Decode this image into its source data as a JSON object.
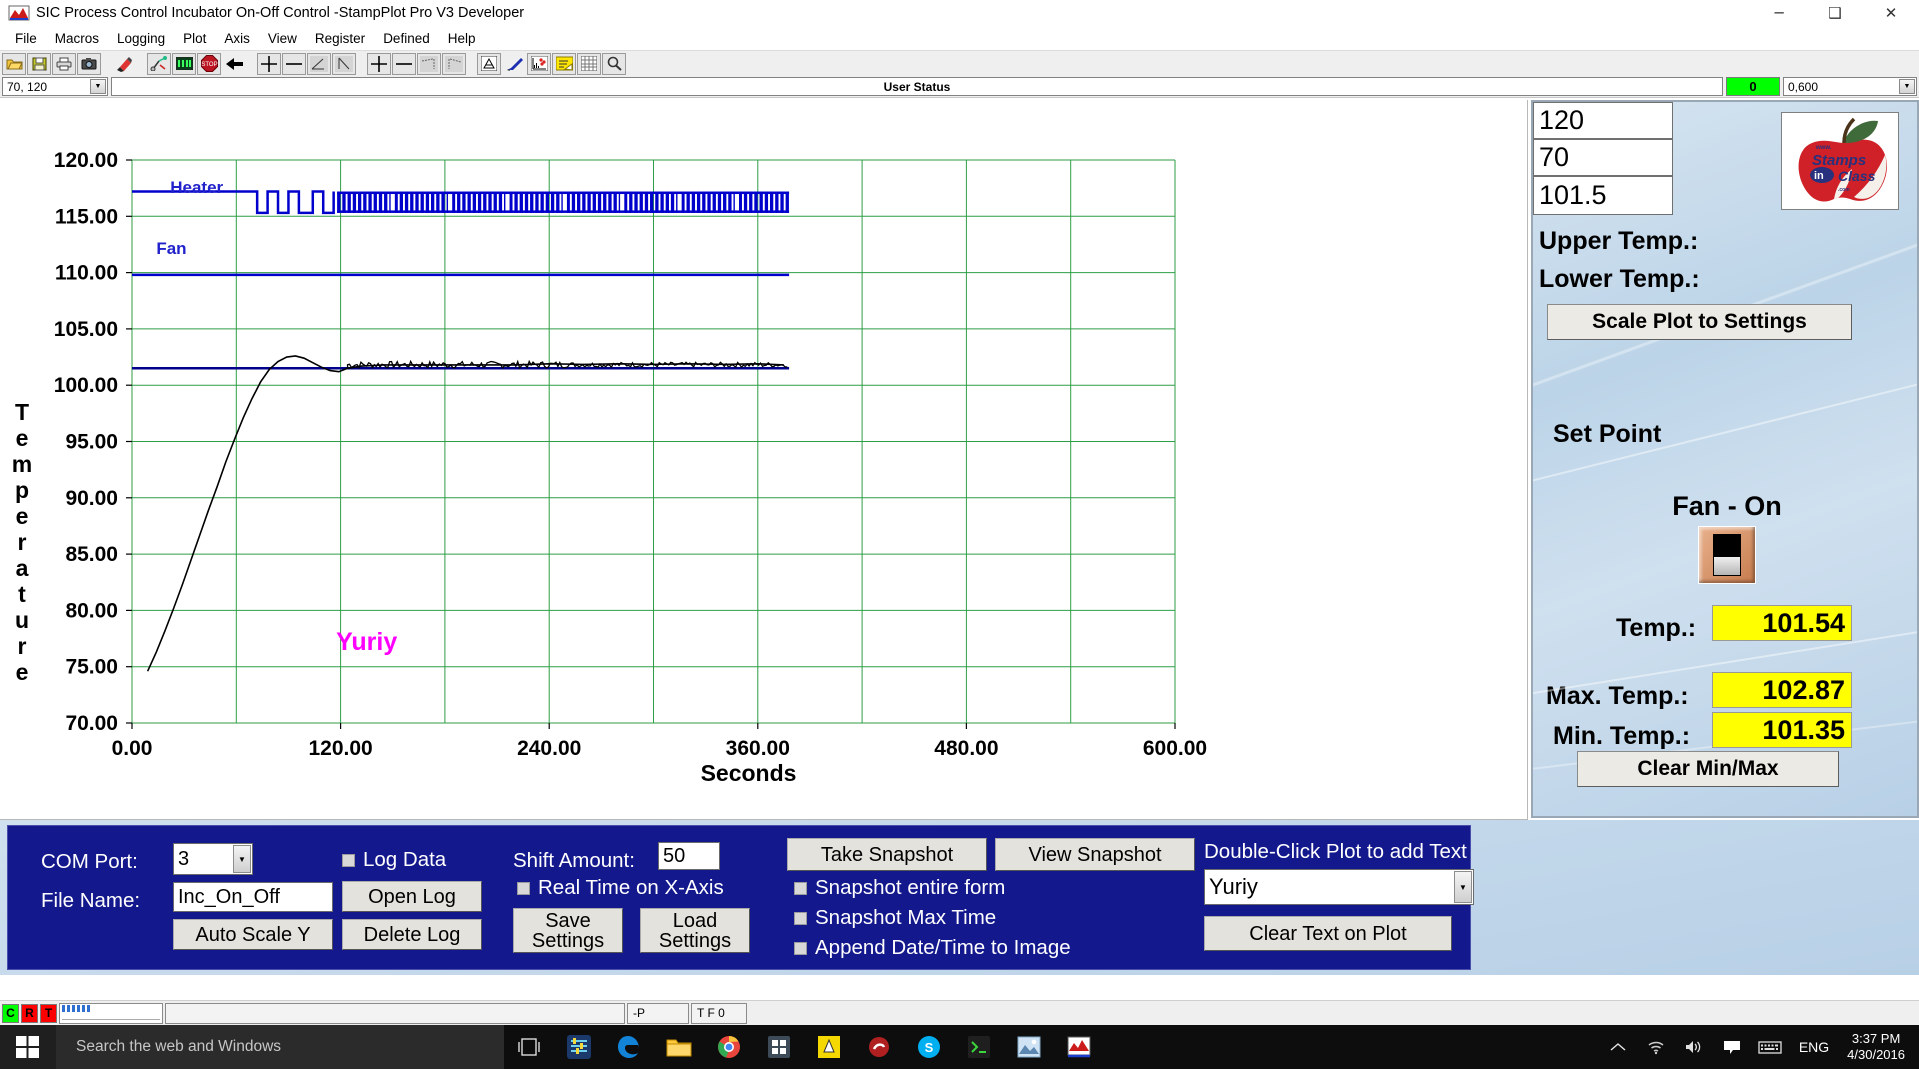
{
  "window": {
    "title": "SIC Process Control Incubator On-Off Control -StampPlot Pro V3 Developer",
    "minimize": "─",
    "maximize": "❑",
    "close": "✕"
  },
  "menu": [
    "File",
    "Macros",
    "Logging",
    "Plot",
    "Axis",
    "View",
    "Register",
    "Defined",
    "Help"
  ],
  "toolbar": {
    "icons": [
      "open-folder-icon",
      "save-disk-icon",
      "print-icon",
      "camera-icon",
      "marker-pen-icon",
      "connect-icon",
      "led-display-icon",
      "stop-icon",
      "back-arrow-icon",
      "plus-icon",
      "minus-icon",
      "scale-up-icon",
      "scale-down-icon",
      "plus-x-icon",
      "minus-x-icon",
      "expand-left-icon",
      "expand-right-icon",
      "pdf-icon",
      "pen-icon",
      "data-points-icon",
      "notes-icon",
      "grid-icon",
      "zoom-icon"
    ]
  },
  "statusrow": {
    "range_value": "70, 120",
    "user_status": "User Status",
    "counter": "0",
    "time_range": "0,600"
  },
  "chart_data": {
    "type": "line",
    "title": "",
    "xlabel": "Seconds",
    "ylabel": "Temperature",
    "xlim": [
      0,
      600
    ],
    "ylim": [
      70,
      120
    ],
    "xticks": [
      "0.00",
      "120.00",
      "240.00",
      "360.00",
      "480.00",
      "600.00"
    ],
    "xtick_values": [
      0,
      120,
      240,
      360,
      480,
      600
    ],
    "yticks": [
      "120.00",
      "115.00",
      "110.00",
      "105.00",
      "100.00",
      "95.00",
      "90.00",
      "85.00",
      "80.00",
      "75.00",
      "70.00"
    ],
    "ytick_values": [
      120,
      115,
      110,
      105,
      100,
      95,
      90,
      85,
      80,
      75,
      70
    ],
    "grid": true,
    "grid_color": "#2e9e45",
    "minor_x_step": 60,
    "annotation": {
      "text": "Yuriy",
      "color": "#ff00ff",
      "x": 135,
      "y": 76.5
    },
    "series": [
      {
        "name": "Heater",
        "label_x": 22,
        "label_y": 117.6,
        "color": "#0000cc",
        "type": "digital",
        "baseline": 117.2,
        "high": 117.2,
        "low": 115.3,
        "comment": "digital heater on/off trace plotted near top of plot"
      },
      {
        "name": "Fan",
        "label_x": 14,
        "label_y": 112.2,
        "color": "#0000cc",
        "type": "digital",
        "baseline": 109.8,
        "comment": "fan state line held constant at 109.8 across run"
      },
      {
        "name": "Set Point",
        "color": "#00008b",
        "type": "reference",
        "value": 101.5
      },
      {
        "name": "Temperature",
        "color": "#000000",
        "type": "line",
        "points": [
          [
            9,
            74.6
          ],
          [
            14,
            76.3
          ],
          [
            19,
            78.2
          ],
          [
            24,
            80.2
          ],
          [
            29,
            82.3
          ],
          [
            34,
            84.5
          ],
          [
            39,
            86.7
          ],
          [
            44,
            88.9
          ],
          [
            49,
            91.0
          ],
          [
            54,
            93.2
          ],
          [
            59,
            95.2
          ],
          [
            64,
            97.1
          ],
          [
            69,
            98.8
          ],
          [
            74,
            100.3
          ],
          [
            79,
            101.4
          ],
          [
            84,
            102.1
          ],
          [
            89,
            102.5
          ],
          [
            94,
            102.6
          ],
          [
            99,
            102.4
          ],
          [
            104,
            102.0
          ],
          [
            109,
            101.6
          ],
          [
            114,
            101.3
          ],
          [
            119,
            101.2
          ],
          [
            124,
            101.5
          ],
          [
            132,
            101.7
          ],
          [
            145,
            101.8
          ],
          [
            160,
            101.8
          ],
          [
            180,
            101.8
          ],
          [
            200,
            101.8
          ],
          [
            220,
            101.8
          ],
          [
            240,
            101.9
          ],
          [
            260,
            101.85
          ],
          [
            280,
            101.9
          ],
          [
            300,
            101.85
          ],
          [
            320,
            101.9
          ],
          [
            340,
            101.85
          ],
          [
            360,
            101.9
          ],
          [
            375,
            101.8
          ]
        ]
      }
    ]
  },
  "settings": {
    "upper_temp_label": "Upper Temp.:",
    "upper_temp_value": "120",
    "lower_temp_label": "Lower Temp.:",
    "lower_temp_value": "70",
    "scale_button": "Scale Plot to Settings",
    "set_point_label": "Set Point",
    "set_point_value": "101.5",
    "fan_status": "Fan - On",
    "fan_switch_icon": "toggle-switch-icon",
    "temp_label": "Temp.:",
    "temp_value": "101.54",
    "max_temp_label": "Max. Temp.:",
    "max_temp_value": "102.87",
    "min_temp_label": "Min. Temp.:",
    "min_temp_value": "101.35",
    "clear_button": "Clear Min/Max",
    "logo_alt": "Stamps in Class"
  },
  "controls": {
    "com_port_label": "COM Port:",
    "com_port_value": "3",
    "file_name_label": "File Name:",
    "file_name_value": "Inc_On_Off",
    "auto_scale_button": "Auto Scale Y",
    "log_data_label": "Log Data",
    "open_log_button": "Open Log",
    "delete_log_button": "Delete Log",
    "shift_amount_label": "Shift Amount:",
    "shift_amount_value": "50",
    "real_time_label": "Real Time on X-Axis",
    "save_settings_button": "Save\nSettings",
    "save_settings_line1": "Save",
    "save_settings_line2": "Settings",
    "load_settings_line1": "Load",
    "load_settings_line2": "Settings",
    "take_snapshot_button": "Take Snapshot",
    "view_snapshot_button": "View Snapshot",
    "snapshot_form_label": "Snapshot entire form",
    "snapshot_max_label": "Snapshot Max Time",
    "append_date_label": "Append Date/Time to Image",
    "double_click_label": "Double-Click Plot to add Text",
    "text_value": "Yuriy",
    "clear_text_button": "Clear Text on Plot"
  },
  "appstatus": {
    "ind_c": "C",
    "ind_r": "R",
    "ind_t": "T",
    "field_p": "-P",
    "field_tf0": "T F 0"
  },
  "taskbar": {
    "search_placeholder": "Search the web and Windows",
    "icons": [
      "task-view-icon",
      "mixer-icon",
      "edge-icon",
      "file-explorer-icon",
      "chrome-icon",
      "store-icon",
      "vlc-icon",
      "notes-icon",
      "skype-icon",
      "terminal-icon",
      "photos-icon",
      "stampplot-icon"
    ],
    "language": "ENG",
    "time": "3:37 PM",
    "date": "4/30/2016"
  },
  "colors": {
    "grid": "#2e9e45",
    "trace": "#000000",
    "digital": "#0000cc",
    "annotation": "#ff00ff",
    "panel_blue": "#13188c",
    "highlight_yellow": "#ffff00",
    "green_status": "#00ff00"
  }
}
